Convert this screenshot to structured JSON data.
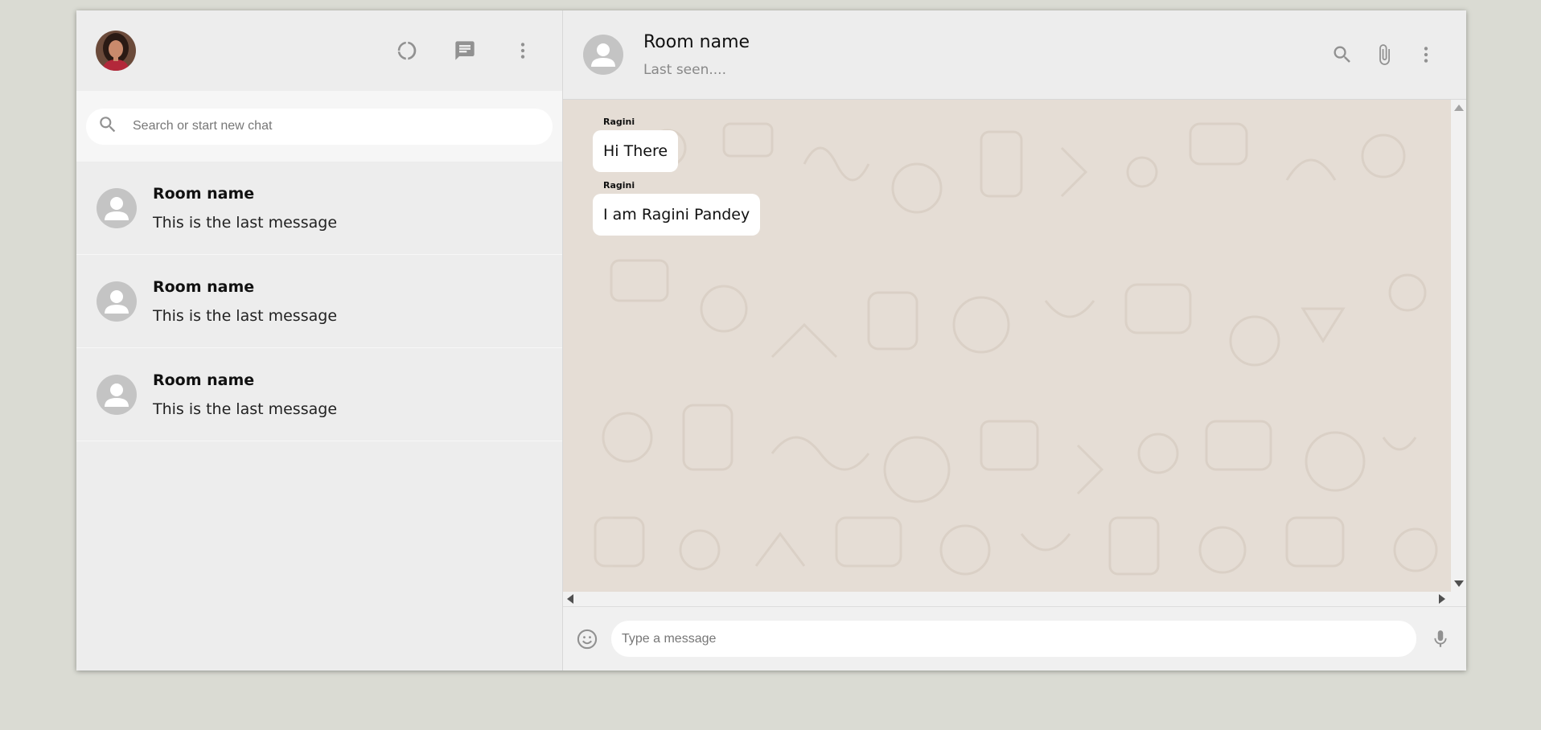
{
  "colors": {
    "page_background": "#dadbd3",
    "panel": "#ededed",
    "chat_wallpaper": "#e5ddd5",
    "icon": "#919191",
    "avatar_placeholder": "#c4c4c4"
  },
  "sidebar": {
    "user_avatar": "user-profile-photo",
    "header_icons": [
      "status-icon",
      "new-chat-icon",
      "more-vert-icon"
    ],
    "search": {
      "placeholder": "Search or start new chat",
      "value": ""
    },
    "chats": [
      {
        "name": "Room name",
        "last_message": "This is the last message"
      },
      {
        "name": "Room name",
        "last_message": "This is the last message"
      },
      {
        "name": "Room name",
        "last_message": "This is the last message"
      }
    ]
  },
  "chat": {
    "header": {
      "room_name": "Room name",
      "last_seen": "Last seen....",
      "icons": [
        "search-icon",
        "attach-icon",
        "more-vert-icon"
      ]
    },
    "messages": [
      {
        "author": "Ragini",
        "text": "Hi There"
      },
      {
        "author": "Ragini",
        "text": "I am Ragini Pandey"
      }
    ],
    "footer": {
      "emoji_icon": "emoji-icon",
      "input_placeholder": "Type a message",
      "input_value": "",
      "mic_icon": "mic-icon"
    }
  }
}
